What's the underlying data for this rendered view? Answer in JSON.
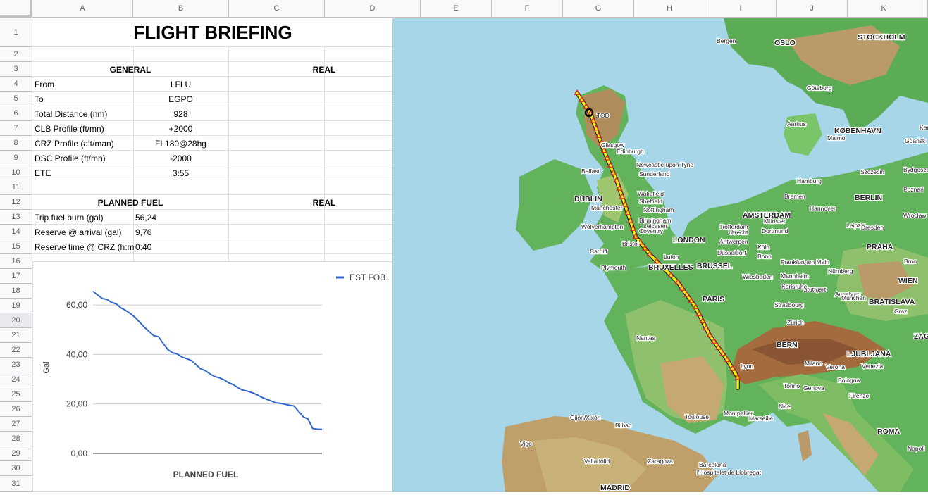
{
  "columns": [
    "A",
    "B",
    "C",
    "D",
    "E",
    "F",
    "G",
    "H",
    "I",
    "J",
    "K"
  ],
  "rows": [
    "1",
    "2",
    "3",
    "4",
    "5",
    "6",
    "7",
    "8",
    "9",
    "10",
    "11",
    "12",
    "13",
    "14",
    "15",
    "16",
    "17",
    "18",
    "19",
    "20",
    "21",
    "22",
    "23",
    "24",
    "25",
    "26",
    "27",
    "28",
    "29",
    "30",
    "31"
  ],
  "sheet": {
    "title": "FLIGHT BRIEFING",
    "general_header": "GENERAL",
    "real_header": "REAL",
    "general": [
      {
        "label": "From",
        "value": "LFLU"
      },
      {
        "label": "To",
        "value": "EGPO"
      },
      {
        "label": "Total Distance (nm)",
        "value": "928"
      },
      {
        "label": "CLB Profile (ft/mn)",
        "value": "+2000"
      },
      {
        "label": "CRZ Profile (alt/man)",
        "value": "FL180@28hg"
      },
      {
        "label": "DSC Profile (ft/mn)",
        "value": "-2000"
      },
      {
        "label": "ETE",
        "value": "3:55"
      }
    ],
    "fuel_header": "PLANNED FUEL",
    "fuel_real_header": "REAL",
    "fuel": [
      {
        "label": "Trip fuel burn (gal)",
        "value": "56,24"
      },
      {
        "label": "Reserve @ arrival (gal)",
        "value": "9,76"
      },
      {
        "label": "Reserve time @ CRZ (h:m)",
        "value": "0:40"
      }
    ]
  },
  "chart_data": {
    "type": "line",
    "title": "PLANNED FUEL",
    "xlabel": "PLANNED FUEL",
    "ylabel": "Gal",
    "ylim": [
      0,
      66
    ],
    "yticks": [
      "0,00",
      "20,00",
      "40,00",
      "60,00"
    ],
    "ytick_values": [
      0,
      20,
      40,
      60
    ],
    "legend_position": "top-right",
    "grid": true,
    "series": [
      {
        "name": "EST FOB",
        "color": "#3366cc",
        "values": [
          65.5,
          64.0,
          62.6,
          62.2,
          61.0,
          60.4,
          58.8,
          57.8,
          56.5,
          55.0,
          53.0,
          51.0,
          49.3,
          47.6,
          47.2,
          44.5,
          42.0,
          40.7,
          40.2,
          39.0,
          38.3,
          37.6,
          36.0,
          34.2,
          33.5,
          32.2,
          31.1,
          30.6,
          29.8,
          28.6,
          27.8,
          26.6,
          25.6,
          25.2,
          24.6,
          23.8,
          22.8,
          22.0,
          21.3,
          20.5,
          20.3,
          19.9,
          19.5,
          19.2,
          17.0,
          14.8,
          13.9,
          10.1,
          9.8,
          9.76
        ]
      }
    ]
  },
  "map": {
    "colors": {
      "sea": "#a7d6e8",
      "lowland": "#63b35c",
      "midland": "#c9b27a",
      "highland": "#a36b3e",
      "route": "#f5f500",
      "route_outline": "#222222",
      "waypoint": "#e03030"
    },
    "labels": {
      "cities_big": [
        "DUBLIN",
        "LONDON",
        "BRUXELLES",
        "BRUSSEL",
        "PARIS",
        "AMSTERDAM",
        "BERLIN",
        "KØBENHAVN",
        "BERN",
        "LJUBLJANA",
        "BRATISLAVA",
        "WIEN",
        "PRAHA",
        "ZAGREB",
        "ROMA",
        "MADRID",
        "OSLO",
        "STOCKHOLM"
      ],
      "cities_small": [
        "TOD",
        "Glasgow",
        "Edinburgh",
        "Belfast",
        "Newcastle upon Tyne",
        "Sunderland",
        "Wakefield",
        "Sheffield",
        "Nottingham",
        "Manchester",
        "Wolverhampton",
        "Birmingham",
        "Leicester",
        "Coventry",
        "Bristol",
        "Cardiff",
        "Plymouth",
        "Luton",
        "Nantes",
        "Lyon",
        "Toulouse",
        "Montpellier",
        "Marseille",
        "Nice",
        "Torino",
        "Genova",
        "Milano",
        "Verona",
        "Venezia",
        "Bologna",
        "Firenze",
        "Napoli",
        "Barcelona",
        "l'Hospitalet de Llobregat",
        "Zaragoza",
        "Valladolid",
        "Vigo",
        "Gijón/Xixón",
        "Bilbao",
        "Zürich",
        "Strasbourg",
        "Stuttgart",
        "Karlsruhe",
        "Mannheim",
        "Frankfurt am Main",
        "Nürnberg",
        "Augsburg",
        "München",
        "Wiesbaden",
        "Köln",
        "Bonn",
        "Düsseldorf",
        "Antwerpen",
        "Rotterdam",
        "Utrecht",
        "Münster",
        "Dortmund",
        "Hannover",
        "Bremen",
        "Hamburg",
        "Leipzig",
        "Dresden",
        "Szczecin",
        "Bydgoszcz",
        "Poznań",
        "Wrocław",
        "Gdańsk",
        "Brno",
        "Graz",
        "Aarhus",
        "Malmö",
        "Göteborg",
        "Bergen",
        "Kaunas"
      ]
    }
  }
}
